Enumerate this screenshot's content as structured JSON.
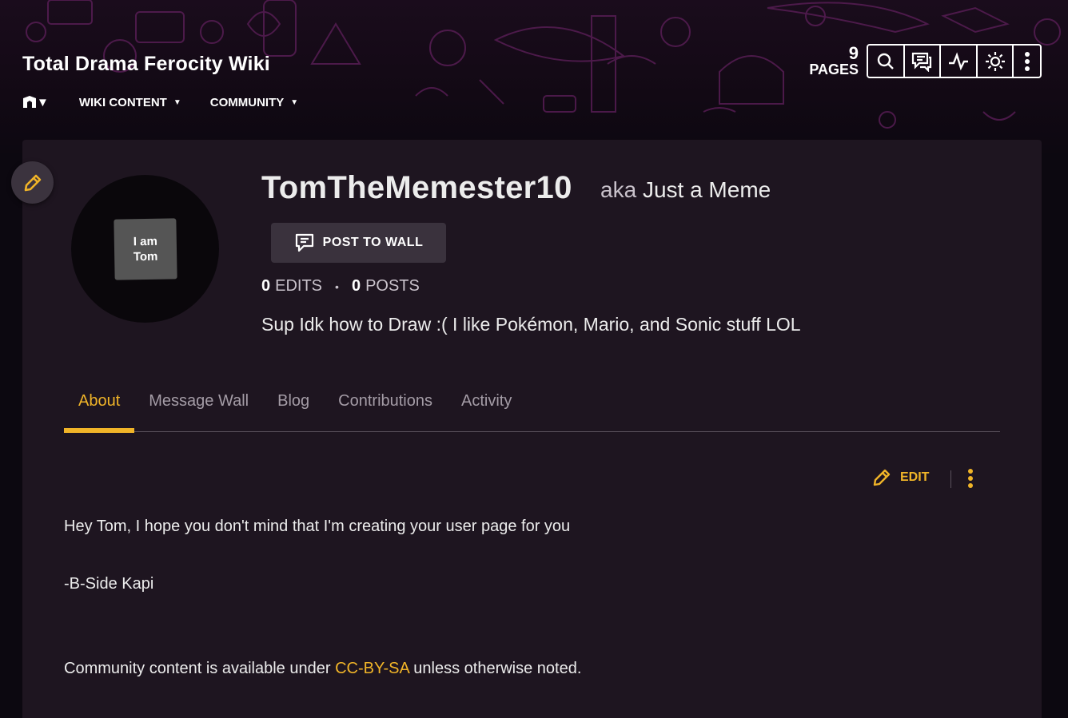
{
  "header": {
    "wiki_title": "Total Drama Ferocity Wiki",
    "nav": [
      {
        "label": "WIKI CONTENT"
      },
      {
        "label": "COMMUNITY"
      }
    ],
    "pages_count": "9",
    "pages_label": "PAGES",
    "tools": [
      "search-icon",
      "discussions-icon",
      "activity-icon",
      "theme-toggle-icon",
      "more-icon"
    ]
  },
  "profile": {
    "avatar_text_line1": "I am",
    "avatar_text_line2": "Tom",
    "username": "TomTheMemester10",
    "aka_prefix": "aka",
    "aka_name": "Just a Meme",
    "post_to_wall_label": "POST TO WALL",
    "edits_count": "0",
    "edits_label": "EDITS",
    "posts_count": "0",
    "posts_label": "POSTS",
    "bio": "Sup Idk how to Draw :( I like Pokémon, Mario, and Sonic stuff LOL"
  },
  "tabs": [
    {
      "label": "About",
      "active": true
    },
    {
      "label": "Message Wall"
    },
    {
      "label": "Blog"
    },
    {
      "label": "Contributions"
    },
    {
      "label": "Activity"
    }
  ],
  "content": {
    "edit_label": "EDIT",
    "body": "Hey Tom, I hope you don't mind that I'm creating your user page for you",
    "signature": "-B-Side Kapi",
    "license_prefix": "Community content is available under",
    "license_link": "CC-BY-SA",
    "license_suffix": "unless otherwise noted."
  },
  "colors": {
    "accent": "#f0b428",
    "panel": "#1e1520",
    "header_pattern": "#5e1f5a"
  }
}
